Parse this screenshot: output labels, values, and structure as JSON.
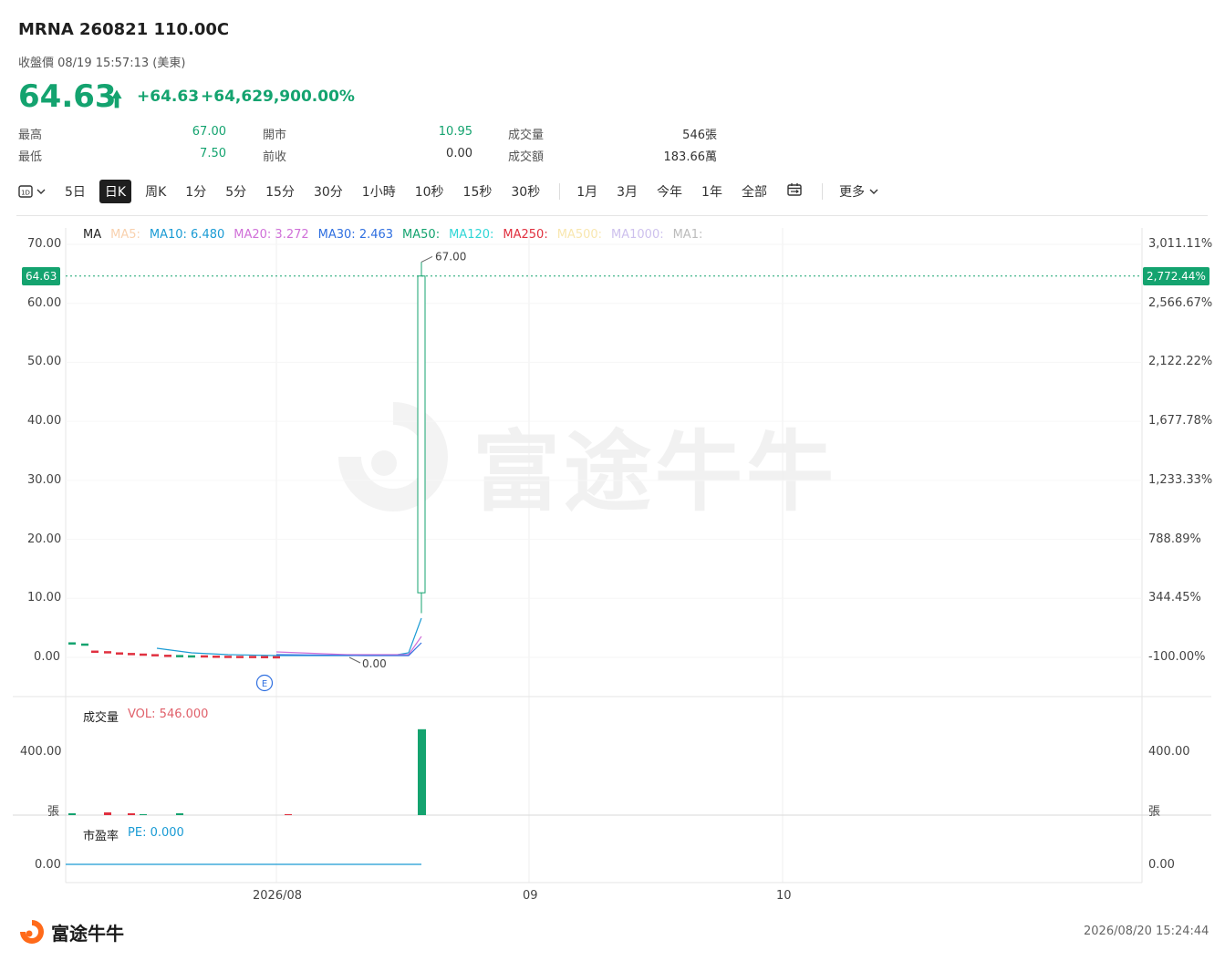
{
  "header": {
    "title": "MRNA 260821 110.00C",
    "subtitle": "收盤價 08/19 15:57:13 (美東)",
    "price": "64.63",
    "change": "+64.63",
    "change_pct": "+64,629,900.00%"
  },
  "stats": {
    "high_label": "最高",
    "high": "67.00",
    "low_label": "最低",
    "low": "7.50",
    "open_label": "開市",
    "open": "10.95",
    "prev_label": "前收",
    "prev": "0.00",
    "volume_label": "成交量",
    "volume": "546張",
    "turnover_label": "成交額",
    "turnover": "183.66萬"
  },
  "toolbar": {
    "period_icon": "calendar-1d-icon",
    "items": [
      "5日",
      "日K",
      "周K",
      "1分",
      "5分",
      "15分",
      "30分",
      "1小時",
      "10秒",
      "15秒",
      "30秒",
      "1月",
      "3月",
      "今年",
      "1年",
      "全部"
    ],
    "active": "日K",
    "more": "更多"
  },
  "ma_legend": {
    "title": "MA",
    "ma5": "MA5:",
    "ma10": "MA10: 6.480",
    "ma20": "MA20: 3.272",
    "ma30": "MA30: 2.463",
    "ma50": "MA50:",
    "ma120": "MA120:",
    "ma250": "MA250:",
    "ma500": "MA500:",
    "ma1000": "MA1000:",
    "ma1x": "MA1:"
  },
  "vol_legend": {
    "title": "成交量",
    "value": "VOL: 546.000"
  },
  "pe_legend": {
    "title": "市盈率",
    "value": "PE: 0.000"
  },
  "colors": {
    "up": "#14a36f",
    "down": "#e0303f",
    "ma5": "#f5b37a",
    "ma10": "#1a9bd4",
    "ma20": "#d070d8",
    "ma30": "#2f6fe0",
    "ma50": "#14a36f",
    "ma120": "#2fd6d6",
    "ma250": "#e0303f",
    "ma500": "#f5d77a",
    "ma1000": "#b9a6e6",
    "ma1x": "#bbbbbb"
  },
  "chart_data": {
    "type": "candlestick",
    "y_left_ticks": [
      "70.00",
      "60.00",
      "50.00",
      "40.00",
      "30.00",
      "20.00",
      "10.00",
      "0.00"
    ],
    "y_right_ticks": [
      "3,011.11%",
      "2,566.67%",
      "2,122.22%",
      "1,677.78%",
      "1,233.33%",
      "788.89%",
      "344.45%",
      "-100.00%"
    ],
    "current_price_tag": "64.63",
    "current_pct_tag": "2,772.44%",
    "high_marker": "67.00",
    "low_marker": "0.00",
    "earnings_marker": "E",
    "x_ticks": [
      "2026/08",
      "09",
      "10"
    ],
    "vol_ticks_left": [
      "400.00",
      "張"
    ],
    "vol_ticks_right": [
      "400.00",
      "張"
    ],
    "pe_ticks": [
      "0.00"
    ],
    "ylim": [
      0,
      70
    ],
    "last_candle": {
      "open": 10.95,
      "high": 67.0,
      "low": 7.5,
      "close": 64.63
    },
    "last_volume": 546
  },
  "footer": {
    "logo_text": "富途牛牛",
    "timestamp": "2026/08/20 15:24:44",
    "watermark": "富途牛牛"
  }
}
